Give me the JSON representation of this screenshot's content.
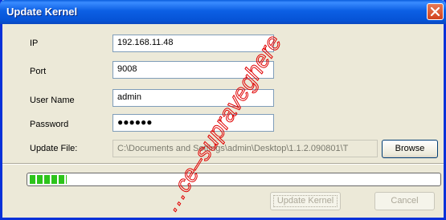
{
  "window": {
    "title": "Update Kernel",
    "close_icon": "close-icon"
  },
  "form": {
    "ip_label": "IP",
    "ip_value": "192.168.11.48",
    "port_label": "Port",
    "port_value": "9008",
    "username_label": "User Name",
    "username_value": "admin",
    "password_label": "Password",
    "password_value": "●●●●●●",
    "file_label": "Update File:",
    "file_value": "C:\\Documents and Settings\\admin\\Desktop\\1.1.2.090801\\T",
    "browse_label": "Browse"
  },
  "progress": {
    "fraction": 0.09
  },
  "actions": {
    "update_label": "Update Kernel",
    "cancel_label": "Cancel"
  },
  "watermark": {
    "text": "…ce–supraveghere"
  },
  "colors": {
    "titlebar": "#0653d6",
    "window_bg": "#ece9d8",
    "progress": "#2dc41b",
    "watermark": "#e00000"
  }
}
